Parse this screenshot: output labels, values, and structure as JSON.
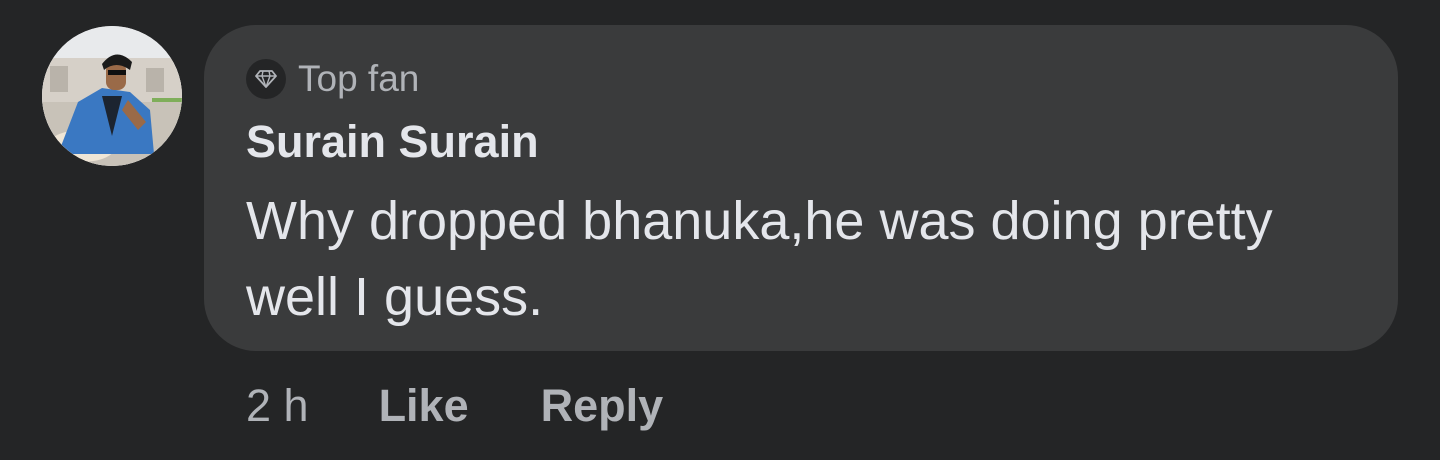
{
  "comment": {
    "badge": {
      "label": "Top fan",
      "icon": "diamond-icon"
    },
    "author": "Surain Surain",
    "text": "Why dropped bhanuka,he was doing pretty well I guess.",
    "avatar": "profile-photo"
  },
  "actions": {
    "time": "2 h",
    "like_label": "Like",
    "reply_label": "Reply"
  },
  "colors": {
    "background": "#242526",
    "bubble": "#3a3b3c",
    "primary_text": "#e4e6eb",
    "secondary_text": "#b0b3b8"
  }
}
